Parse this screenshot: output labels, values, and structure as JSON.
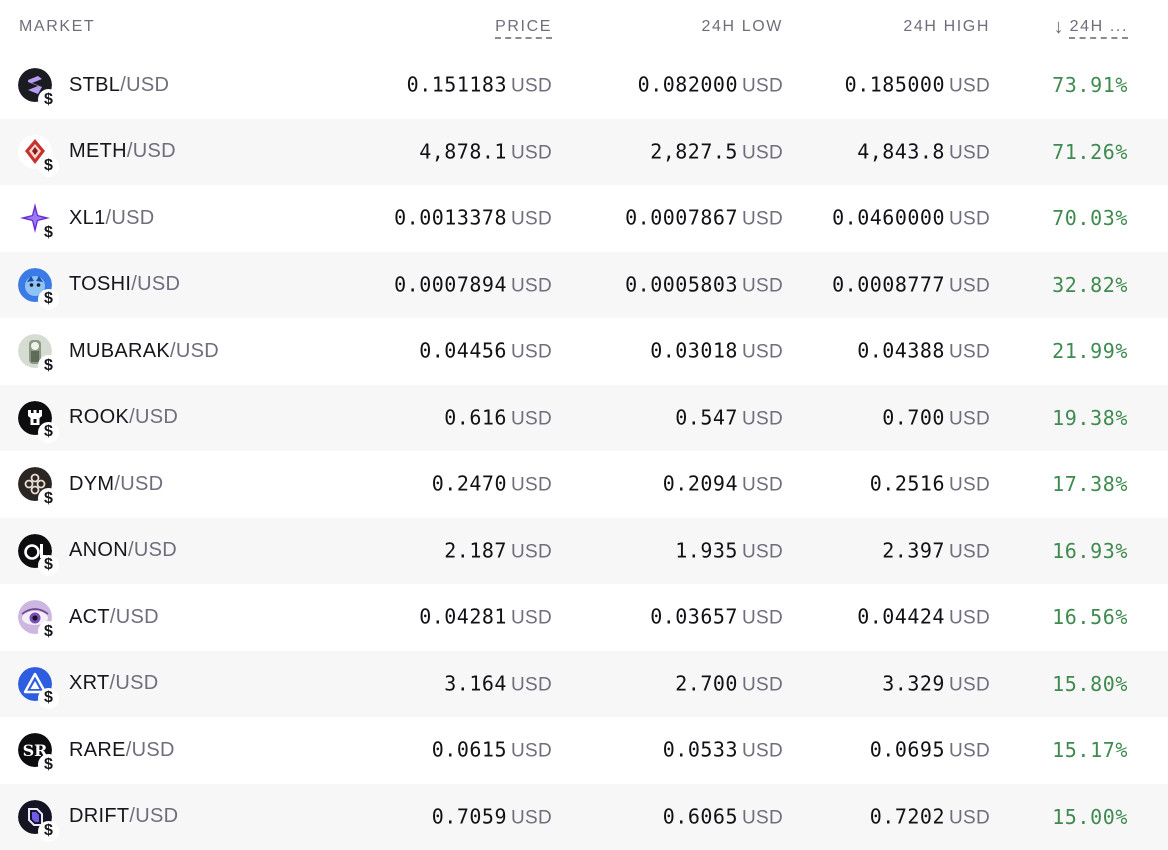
{
  "header": {
    "market": "MARKET",
    "price": "PRICE",
    "low": "24H LOW",
    "high": "24H HIGH",
    "change": "24H ..."
  },
  "unit": "USD",
  "rows": [
    {
      "base": "STBL",
      "quote": "/USD",
      "price": "0.151183",
      "low": "0.082000",
      "high": "0.185000",
      "change": "73.91%",
      "icon": "stbl-icon"
    },
    {
      "base": "METH",
      "quote": "/USD",
      "price": "4,878.1",
      "low": "2,827.5",
      "high": "4,843.8",
      "change": "71.26%",
      "icon": "meth-icon"
    },
    {
      "base": "XL1",
      "quote": "/USD",
      "price": "0.0013378",
      "low": "0.0007867",
      "high": "0.0460000",
      "change": "70.03%",
      "icon": "xl1-icon"
    },
    {
      "base": "TOSHI",
      "quote": "/USD",
      "price": "0.0007894",
      "low": "0.0005803",
      "high": "0.0008777",
      "change": "32.82%",
      "icon": "toshi-icon"
    },
    {
      "base": "MUBARAK",
      "quote": "/USD",
      "price": "0.04456",
      "low": "0.03018",
      "high": "0.04388",
      "change": "21.99%",
      "icon": "mubarak-icon"
    },
    {
      "base": "ROOK",
      "quote": "/USD",
      "price": "0.616",
      "low": "0.547",
      "high": "0.700",
      "change": "19.38%",
      "icon": "rook-icon"
    },
    {
      "base": "DYM",
      "quote": "/USD",
      "price": "0.2470",
      "low": "0.2094",
      "high": "0.2516",
      "change": "17.38%",
      "icon": "dym-icon"
    },
    {
      "base": "ANON",
      "quote": "/USD",
      "price": "2.187",
      "low": "1.935",
      "high": "2.397",
      "change": "16.93%",
      "icon": "anon-icon"
    },
    {
      "base": "ACT",
      "quote": "/USD",
      "price": "0.04281",
      "low": "0.03657",
      "high": "0.04424",
      "change": "16.56%",
      "icon": "act-icon"
    },
    {
      "base": "XRT",
      "quote": "/USD",
      "price": "3.164",
      "low": "2.700",
      "high": "3.329",
      "change": "15.80%",
      "icon": "xrt-icon"
    },
    {
      "base": "RARE",
      "quote": "/USD",
      "price": "0.0615",
      "low": "0.0533",
      "high": "0.0695",
      "change": "15.17%",
      "icon": "rare-icon"
    },
    {
      "base": "DRIFT",
      "quote": "/USD",
      "price": "0.7059",
      "low": "0.6065",
      "high": "0.7202",
      "change": "15.00%",
      "icon": "drift-icon"
    }
  ],
  "badge": "$",
  "sort": {
    "column": "change",
    "direction": "descending",
    "icon": "arrow-down-icon"
  },
  "colors": {
    "positive": "#3f8a4f",
    "muted": "#6e6e7c",
    "alt_row": "#f7f7f8"
  }
}
